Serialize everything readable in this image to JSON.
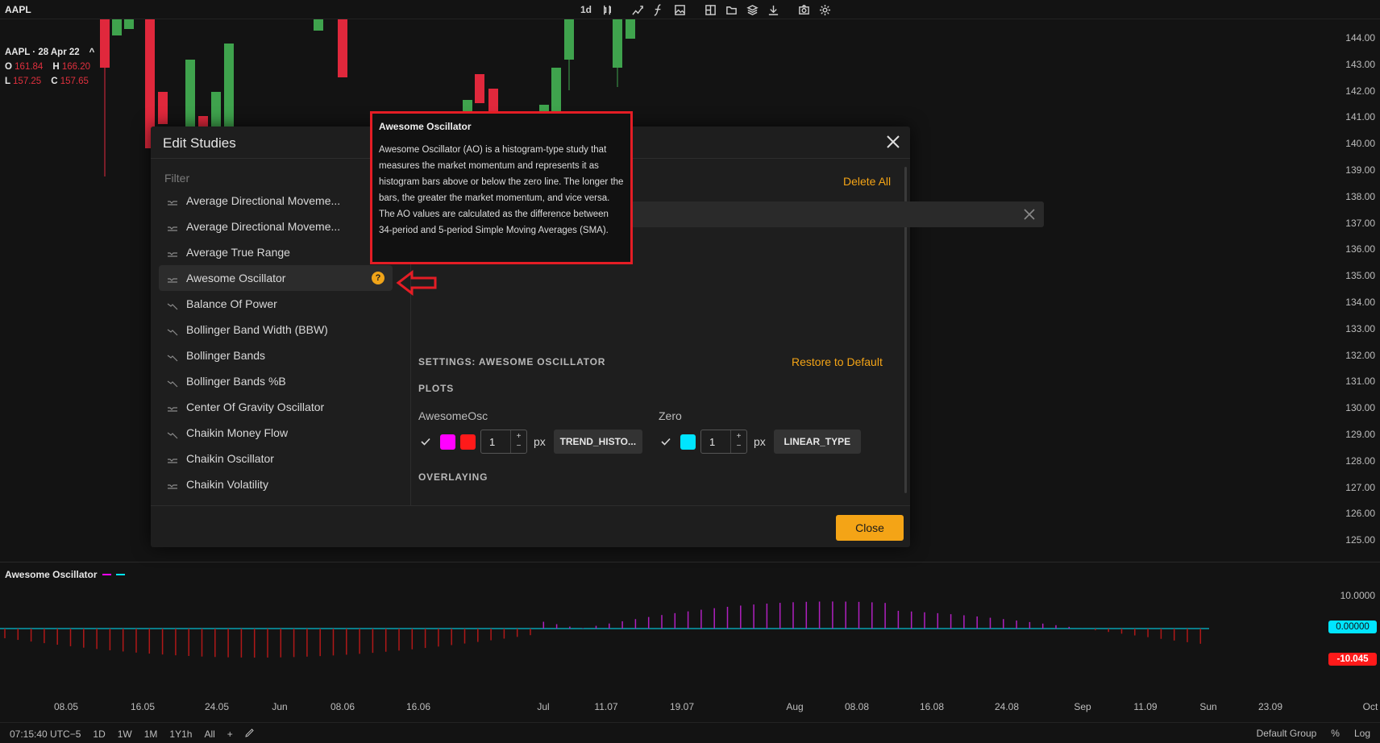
{
  "topbar": {
    "symbol": "AAPL",
    "interval": "1d",
    "tools": [
      "candle-type-icon",
      "drawing-icon",
      "studies-icon",
      "image-icon",
      "layout-icon",
      "folder-icon",
      "layers-icon",
      "download-icon",
      "camera-icon",
      "gear-icon"
    ]
  },
  "legend": {
    "header": "AAPL · 28 Apr 22",
    "caret": "^",
    "o_label": "O",
    "o_value": "161.84",
    "h_label": "H",
    "h_value": "166.20",
    "l_label": "L",
    "l_value": "157.25",
    "c_label": "C",
    "c_value": "157.65"
  },
  "price_axis": [
    "144.00",
    "143.00",
    "142.00",
    "141.00",
    "140.00",
    "139.00",
    "138.00",
    "137.00",
    "136.00",
    "135.00",
    "134.00",
    "133.00",
    "132.00",
    "131.00",
    "130.00",
    "129.00",
    "128.00",
    "127.00",
    "126.00",
    "125.00"
  ],
  "ao_pane": {
    "title": "Awesome Oscillator",
    "axis_label": "10.0000",
    "zero_badge": "0.00000",
    "current_badge": "-10.045"
  },
  "time_axis": [
    "08.05",
    "16.05",
    "24.05",
    "Jun",
    "08.06",
    "16.06",
    "Jul",
    "11.07",
    "19.07",
    "Aug",
    "08.08",
    "16.08",
    "24.08",
    "Sep",
    "11.09",
    "Sun",
    "23.09",
    "Oct"
  ],
  "bottombar": {
    "time": "07:15:40 UTC−5",
    "ranges": [
      "1D",
      "1W",
      "1M",
      "1Y1h",
      "All"
    ],
    "plus": "+",
    "group": "Default Group",
    "percent": "%",
    "log": "Log"
  },
  "modal": {
    "title": "Edit Studies",
    "filter_placeholder": "Filter",
    "delete_all": "Delete All",
    "studies": [
      {
        "label": "Average Directional Moveme...",
        "icon": "oscillator-icon"
      },
      {
        "label": "Average Directional Moveme...",
        "icon": "oscillator-icon"
      },
      {
        "label": "Average True Range",
        "icon": "oscillator-icon"
      },
      {
        "label": "Awesome Oscillator",
        "icon": "oscillator-icon",
        "selected": true
      },
      {
        "label": "Balance Of Power",
        "icon": "overlay-icon"
      },
      {
        "label": "Bollinger Band Width (BBW)",
        "icon": "overlay-icon"
      },
      {
        "label": "Bollinger Bands",
        "icon": "overlay-icon"
      },
      {
        "label": "Bollinger Bands %B",
        "icon": "overlay-icon"
      },
      {
        "label": "Center Of Gravity Oscillator",
        "icon": "oscillator-icon"
      },
      {
        "label": "Chaikin Money Flow",
        "icon": "overlay-icon"
      },
      {
        "label": "Chaikin Oscillator",
        "icon": "oscillator-icon"
      },
      {
        "label": "Chaikin Volatility",
        "icon": "oscillator-icon"
      }
    ],
    "help_glyph": "?",
    "settings_title": "SETTINGS: AWESOME OSCILLATOR",
    "restore": "Restore to Default",
    "plots_title": "PLOTS",
    "overlaying_title": "OVERLAYING",
    "plots": [
      {
        "name": "AwesomeOsc",
        "width": "1",
        "unit": "px",
        "type": "TREND_HISTO...",
        "colors": [
          "#ff00ff",
          "#ff1a1a"
        ]
      },
      {
        "name": "Zero",
        "width": "1",
        "unit": "px",
        "type": "LINEAR_TYPE",
        "colors": [
          "#00e5ff"
        ]
      }
    ],
    "close_label": "Close"
  },
  "tooltip": {
    "title": "Awesome Oscillator",
    "body": "Awesome Oscillator (AO) is a histogram-type study that measures the market momentum and represents it as histogram bars above or below the zero line. The longer the bars, the greater the market momentum, and vice versa. The AO values are calculated as the difference between 34-period and 5-period Simple Moving Averages (SMA)."
  },
  "colors": {
    "up": "#3fa34d",
    "down": "#e0283c",
    "accent": "#f4a416",
    "ao_positive": "#b020c0",
    "ao_negative": "#b01818",
    "zero_line": "#00e5ff"
  }
}
